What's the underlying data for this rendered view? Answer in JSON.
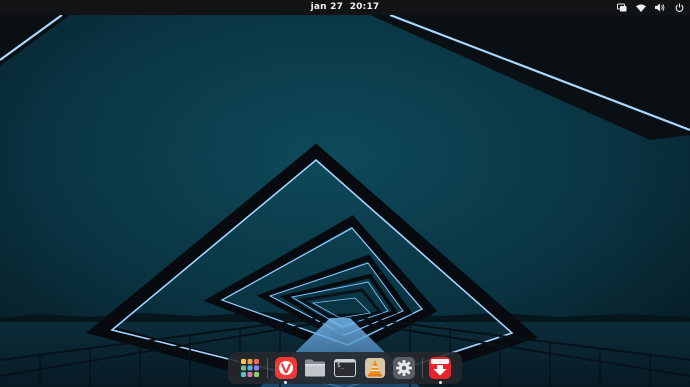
{
  "topbar": {
    "clock": {
      "date": "jan 27",
      "time": "20:17"
    },
    "tray": [
      {
        "name": "screen-share-icon"
      },
      {
        "name": "wifi-icon"
      },
      {
        "name": "volume-icon"
      },
      {
        "name": "power-icon"
      }
    ]
  },
  "dock": {
    "items": [
      {
        "name": "app-grid-button",
        "active": false
      },
      {
        "name": "vivaldi-browser-button",
        "active": true
      },
      {
        "name": "files-button",
        "active": false
      },
      {
        "name": "terminal-button",
        "active": false,
        "prompt": "$_"
      },
      {
        "name": "vlc-button",
        "active": false
      },
      {
        "name": "settings-button",
        "active": false
      },
      {
        "name": "downloader-button",
        "active": true
      }
    ]
  },
  "colors": {
    "topbar": "#111315",
    "accent_glow": "#9fd4ff",
    "wallpaper_sky": "#0b3846",
    "vivaldi": "#ef3939",
    "downloader": "#e8232a"
  }
}
